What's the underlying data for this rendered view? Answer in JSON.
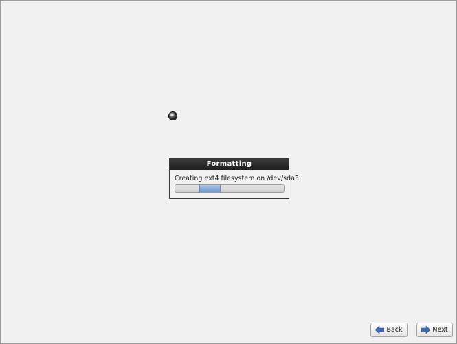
{
  "dialog": {
    "title": "Formatting",
    "message": "Creating ext4 filesystem on /dev/sda3",
    "progress": {
      "indeterminate": true,
      "pulse_start": 0.22,
      "pulse_end": 0.42
    }
  },
  "nav": {
    "back_label": "Back",
    "back_icon": "arrow-left-icon",
    "next_label": "Next",
    "next_icon": "arrow-right-icon"
  },
  "colors": {
    "background": "#f1f1f1",
    "title_bar": "#262626",
    "progress_fill": "#7ea3d8",
    "arrow_icon": "#3b6db5"
  }
}
